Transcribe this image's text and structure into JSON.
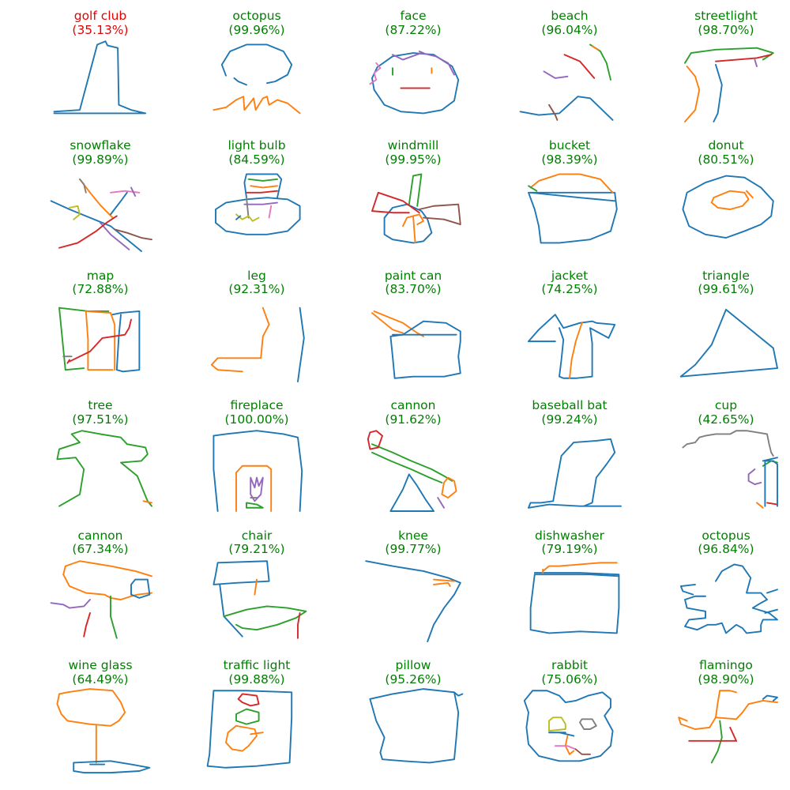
{
  "colors": {
    "correct": "#008000",
    "incorrect": "#e60000",
    "strokes": [
      "#1f77b4",
      "#ff7f0e",
      "#2ca02c",
      "#d62728",
      "#9467bd",
      "#8c564b",
      "#e377c2",
      "#7f7f7f",
      "#bcbd22"
    ]
  },
  "grid": {
    "rows": 6,
    "cols": 5,
    "items": [
      {
        "label": "golf club",
        "confidence": "(35.13%)",
        "correct": false
      },
      {
        "label": "octopus",
        "confidence": "(99.96%)",
        "correct": true
      },
      {
        "label": "face",
        "confidence": "(87.22%)",
        "correct": true
      },
      {
        "label": "beach",
        "confidence": "(96.04%)",
        "correct": true
      },
      {
        "label": "streetlight",
        "confidence": "(98.70%)",
        "correct": true
      },
      {
        "label": "snowflake",
        "confidence": "(99.89%)",
        "correct": true
      },
      {
        "label": "light bulb",
        "confidence": "(84.59%)",
        "correct": true
      },
      {
        "label": "windmill",
        "confidence": "(99.95%)",
        "correct": true
      },
      {
        "label": "bucket",
        "confidence": "(98.39%)",
        "correct": true
      },
      {
        "label": "donut",
        "confidence": "(80.51%)",
        "correct": true
      },
      {
        "label": "map",
        "confidence": "(72.88%)",
        "correct": true
      },
      {
        "label": "leg",
        "confidence": "(92.31%)",
        "correct": true
      },
      {
        "label": "paint can",
        "confidence": "(83.70%)",
        "correct": true
      },
      {
        "label": "jacket",
        "confidence": "(74.25%)",
        "correct": true
      },
      {
        "label": "triangle",
        "confidence": "(99.61%)",
        "correct": true
      },
      {
        "label": "tree",
        "confidence": "(97.51%)",
        "correct": true
      },
      {
        "label": "fireplace",
        "confidence": "(100.00%)",
        "correct": true
      },
      {
        "label": "cannon",
        "confidence": "(91.62%)",
        "correct": true
      },
      {
        "label": "baseball bat",
        "confidence": "(99.24%)",
        "correct": true
      },
      {
        "label": "cup",
        "confidence": "(42.65%)",
        "correct": true
      },
      {
        "label": "cannon",
        "confidence": "(67.34%)",
        "correct": true
      },
      {
        "label": "chair",
        "confidence": "(79.21%)",
        "correct": true
      },
      {
        "label": "knee",
        "confidence": "(99.77%)",
        "correct": true
      },
      {
        "label": "dishwasher",
        "confidence": "(79.19%)",
        "correct": true
      },
      {
        "label": "octopus",
        "confidence": "(96.84%)",
        "correct": true
      },
      {
        "label": "wine glass",
        "confidence": "(64.49%)",
        "correct": true
      },
      {
        "label": "traffic light",
        "confidence": "(99.88%)",
        "correct": true
      },
      {
        "label": "pillow",
        "confidence": "(95.26%)",
        "correct": true
      },
      {
        "label": "rabbit",
        "confidence": "(75.06%)",
        "correct": true
      },
      {
        "label": "flamingo",
        "confidence": "(98.90%)",
        "correct": true
      }
    ]
  }
}
